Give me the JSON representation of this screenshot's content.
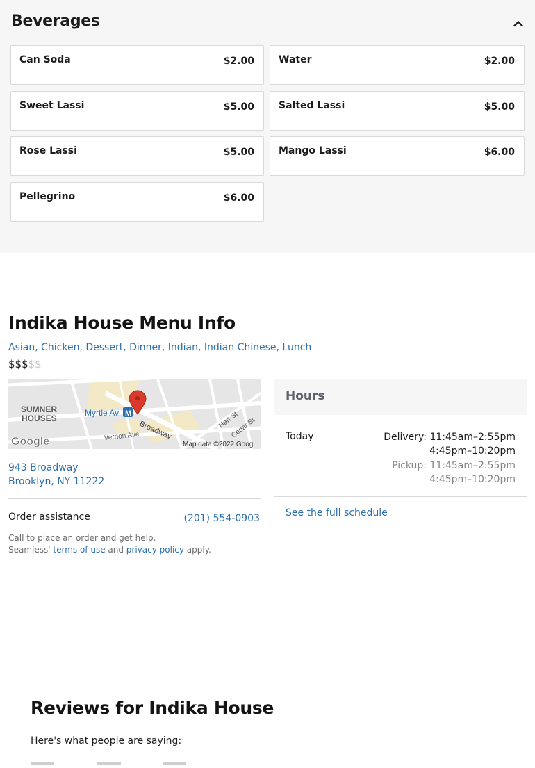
{
  "menu": {
    "section_title": "Beverages",
    "items": [
      {
        "name": "Can Soda",
        "price": "$2.00"
      },
      {
        "name": "Water",
        "price": "$2.00"
      },
      {
        "name": "Sweet Lassi",
        "price": "$5.00"
      },
      {
        "name": "Salted Lassi",
        "price": "$5.00"
      },
      {
        "name": "Rose Lassi",
        "price": "$5.00"
      },
      {
        "name": "Mango Lassi",
        "price": "$6.00"
      },
      {
        "name": "Pellegrino",
        "price": "$6.00"
      }
    ],
    "icons": {
      "collapse": "chevron-up-icon"
    }
  },
  "info": {
    "title": "Indika House Menu Info",
    "cuisines": "Asian, Chicken, Dessert, Dinner, Indian, Indian Chinese, Lunch",
    "price_active": "$$$",
    "price_inactive": "$$",
    "map": {
      "labels": {
        "neighborhood_1": "SUMNER",
        "neighborhood_2": "HOUSES",
        "station": "Myrtle Av",
        "subway_line": "M",
        "street_broadway": "Broadway",
        "street_vernon": "Vernon Ave",
        "street_hart": "Hart St",
        "street_cedar": "Cedar St",
        "attribution": "Map data ©2022 Googl",
        "logo": "Google"
      },
      "icons": {
        "pin": "map-pin-icon"
      }
    },
    "address_line1": "943 Broadway",
    "address_line2": "Brooklyn, NY 11222",
    "order_label": "Order assistance",
    "order_phone": "(201) 554-0903",
    "order_help_line1": "Call to place an order and get help.",
    "order_help_prefix": "Seamless' ",
    "terms_link": "terms of use",
    "and_text": " and ",
    "privacy_link": "privacy policy",
    "apply_text": " apply."
  },
  "hours": {
    "title": "Hours",
    "day": "Today",
    "delivery_line1": "Delivery: 11:45am–2:55pm",
    "delivery_line2": "4:45pm–10:20pm",
    "pickup_line1": "Pickup: 11:45am–2:55pm",
    "pickup_line2": "4:45pm–10:20pm",
    "full_schedule": "See the full schedule"
  },
  "reviews": {
    "title": "Reviews for Indika House",
    "subtitle": "Here's what people are saying:"
  },
  "colors": {
    "link": "#2b6fad",
    "section_bg": "#f6f6f7",
    "pin": "#d93a2b"
  }
}
